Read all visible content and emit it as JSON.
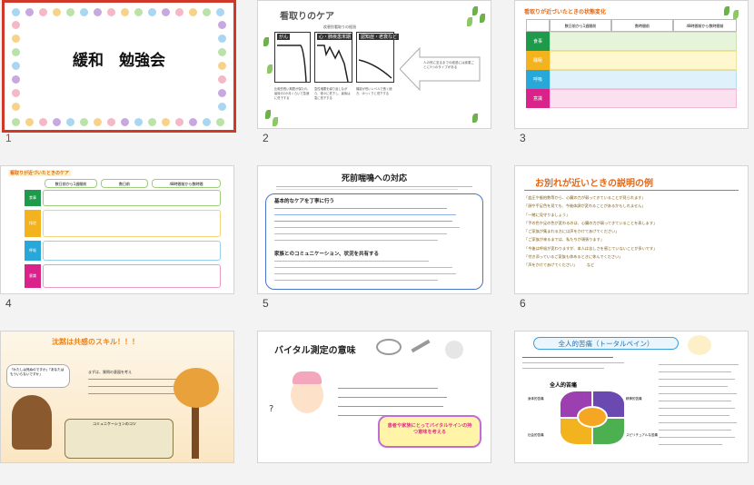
{
  "slides": [
    {
      "number": "1",
      "title": "緩和　勉強会"
    },
    {
      "number": "2",
      "title": "看取りのケア",
      "subtitle": "疾患別看取りの経過",
      "labels": [
        "がん",
        "心・肺疾患末期",
        "認知症・老衰など"
      ],
      "arrow_text": "人の死に至るまでの経過には疾患ごとに3つのタイプがある",
      "captions": [
        "比較的長い期間が保たれ、最後の2か月くらいで急速に低下する",
        "急性増悪を繰り返しながら、徐々に低下し、最後は急に低下する",
        "機能が低いレベルで長く続き、ゆっくりと低下する"
      ]
    },
    {
      "number": "3",
      "title": "看取りが近づいたときの状態変化",
      "headers": [
        "数日前から1週間前",
        "数時間前",
        "48時間前から数時間前"
      ],
      "rows": [
        "食事",
        "睡眠",
        "呼吸",
        "意識"
      ]
    },
    {
      "number": "4",
      "title": "看取りが近づいたときのケア",
      "headers": [
        "数日前から1週間前",
        "数日前",
        "48時間前から数時間"
      ],
      "rows": [
        "食事",
        "排泄",
        "呼吸",
        "意識"
      ]
    },
    {
      "number": "5",
      "title": "死前喘鳴への対応",
      "section1": "基本的なケアを丁寧に行う",
      "section2": "家族とのコミュニケーション、状況を共有する"
    },
    {
      "number": "6",
      "title": "お別れが近いときの説明の例",
      "lines": [
        "「血圧や脈拍数等から、心臓の力が弱ってきていることが見られます」",
        "「顔や手足色を見ても、今後体調が変わることがあるかもしれません」",
        "「一緒に見守りましょう」",
        "「手の色や足の色が変わるのは、心臓の力が弱ってきていることを表します」",
        "「ご家族が集まれる方には声をかけてあげてください」",
        "「ご家族が来るまでは、私たちが頑張ります」",
        "「今後は呼吸が変わりますが、本人は苦しさを感じていないことが多いです」",
        "「付き添っているご家族も休めるときに休んでください」",
        "「声をかけてあげてください」"
      ],
      "tail": "など"
    },
    {
      "number": "7",
      "title": "沈黙は共感のスキル！！！",
      "bubble": "「わたしは死ぬのですか」「あなたはもういらないですか」",
      "sub": "まずは、質問の意図を考え",
      "note": "コミュニケーションのコツ"
    },
    {
      "number": "8",
      "title": "バイタル測定の意味",
      "text": "患者や家族にとってバイタルサインの持つ意味を考える"
    },
    {
      "number": "9",
      "title": "全人的苦痛（トータルペイン）",
      "center": "全人的苦痛",
      "quadrants": [
        "身体的苦痛",
        "精神的苦痛",
        "社会的苦痛",
        "スピリチュアルな苦痛"
      ]
    }
  ],
  "colors": {
    "selected_border": "#d0392a"
  }
}
